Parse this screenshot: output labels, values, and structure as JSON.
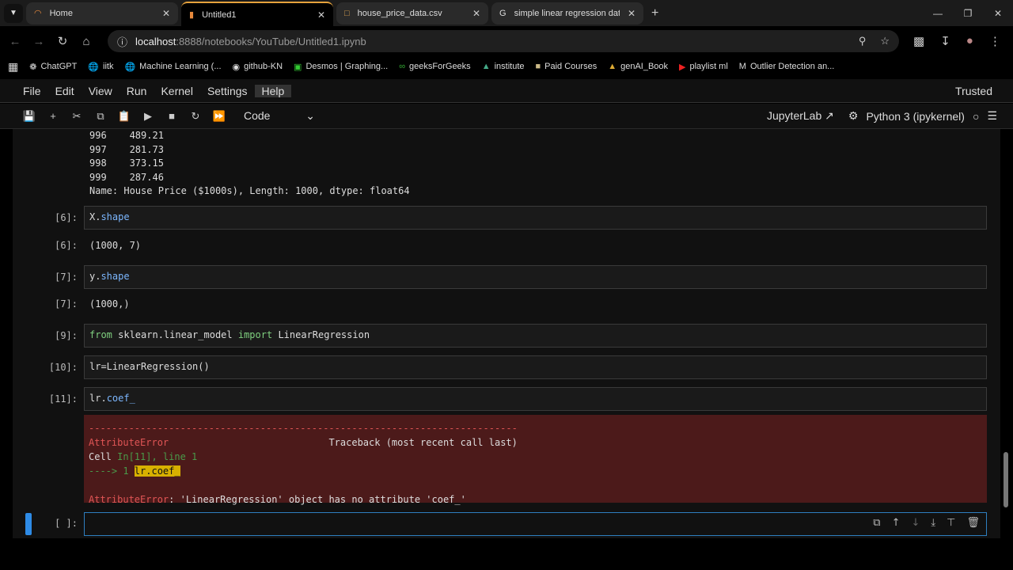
{
  "browser": {
    "tabs": [
      {
        "title": "Home",
        "icon": "jupyter-icon"
      },
      {
        "title": "Untitled1",
        "icon": "notebook-icon",
        "active": true
      },
      {
        "title": "house_price_data.csv",
        "icon": "file-icon"
      },
      {
        "title": "simple linear regression dataset",
        "icon": "google-icon"
      }
    ],
    "url_host": "localhost",
    "url_path": ":8888/notebooks/YouTube/Untitled1.ipynb",
    "bookmarks": [
      "ChatGPT",
      "iitk",
      "Machine Learning (...",
      "github-KN",
      "Desmos | Graphing...",
      "geeksForGeeks",
      "institute",
      "Paid Courses",
      "genAI_Book",
      "playlist ml",
      "Outlier Detection an..."
    ]
  },
  "menu": {
    "items": [
      "File",
      "Edit",
      "View",
      "Run",
      "Kernel",
      "Settings",
      "Help"
    ],
    "trusted": "Trusted"
  },
  "toolbar": {
    "cell_type": "Code",
    "jupyterlab": "JupyterLab",
    "kernel": "Python 3 (ipykernel)"
  },
  "notebook": {
    "output_top": [
      "996    489.21",
      "997    281.73",
      "998    373.15",
      "999    287.46",
      "Name: House Price ($1000s), Length: 1000, dtype: float64"
    ],
    "cells": [
      {
        "in": "[6]:",
        "code_a": "X.",
        "code_b": "shape",
        "out_prompt": "[6]:",
        "out": "(1000, 7)"
      },
      {
        "in": "[7]:",
        "code_a": "y.",
        "code_b": "shape",
        "out_prompt": "[7]:",
        "out": "(1000,)"
      },
      {
        "in": "[9]:",
        "kw1": "from",
        "mid": " sklearn.linear_model ",
        "kw2": "import",
        "rest": " LinearRegression"
      },
      {
        "in": "[10]:",
        "code": "lr=LinearRegression()"
      },
      {
        "in": "[11]:",
        "code_a": "lr.",
        "code_b": "coef_"
      },
      {
        "in": "[ ]:"
      }
    ],
    "error": {
      "dashes": "---------------------------------------------------------------------------",
      "name": "AttributeError",
      "traceback": "Traceback (most recent call last)",
      "cell": "Cell ",
      "cell_ref": "In[11], line 1",
      "arrow": "----> 1 ",
      "hl_code": "lr.coef_",
      "msg": ": 'LinearRegression' object has no attribute 'coef_'"
    }
  }
}
